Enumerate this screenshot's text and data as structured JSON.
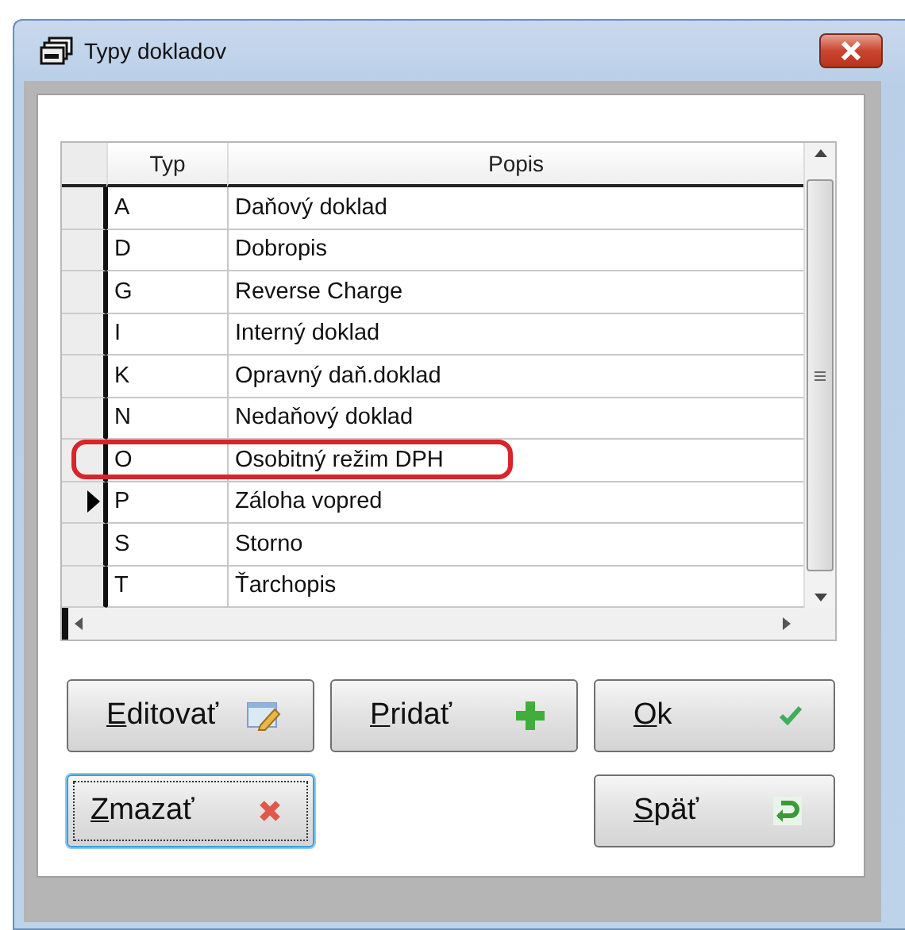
{
  "window": {
    "title": "Typy dokladov"
  },
  "table": {
    "columns": [
      "Typ",
      "Popis"
    ],
    "rows": [
      {
        "typ": "A",
        "popis": "Daňový doklad",
        "current": false,
        "highlighted": false
      },
      {
        "typ": "D",
        "popis": "Dobropis",
        "current": false,
        "highlighted": false
      },
      {
        "typ": "G",
        "popis": "Reverse Charge",
        "current": false,
        "highlighted": false
      },
      {
        "typ": "I",
        "popis": "Interný doklad",
        "current": false,
        "highlighted": false
      },
      {
        "typ": "K",
        "popis": "Opravný daň.doklad",
        "current": false,
        "highlighted": false
      },
      {
        "typ": "N",
        "popis": "Nedaňový doklad",
        "current": false,
        "highlighted": false
      },
      {
        "typ": "O",
        "popis": "Osobitný režim DPH",
        "current": false,
        "highlighted": true
      },
      {
        "typ": "P",
        "popis": "Záloha vopred",
        "current": true,
        "highlighted": false
      },
      {
        "typ": "S",
        "popis": "Storno",
        "current": false,
        "highlighted": false
      },
      {
        "typ": "T",
        "popis": "Ťarchopis",
        "current": false,
        "highlighted": false
      }
    ]
  },
  "buttons": [
    {
      "label": "Editovať",
      "kind": "edit",
      "focused": false
    },
    {
      "label": "Pridať",
      "kind": "add",
      "focused": false
    },
    {
      "label": "Ok",
      "kind": "ok",
      "focused": false
    },
    {
      "label": "Zmazať",
      "kind": "delete",
      "focused": true
    },
    {
      "label": "Späť",
      "kind": "back",
      "focused": false
    }
  ]
}
